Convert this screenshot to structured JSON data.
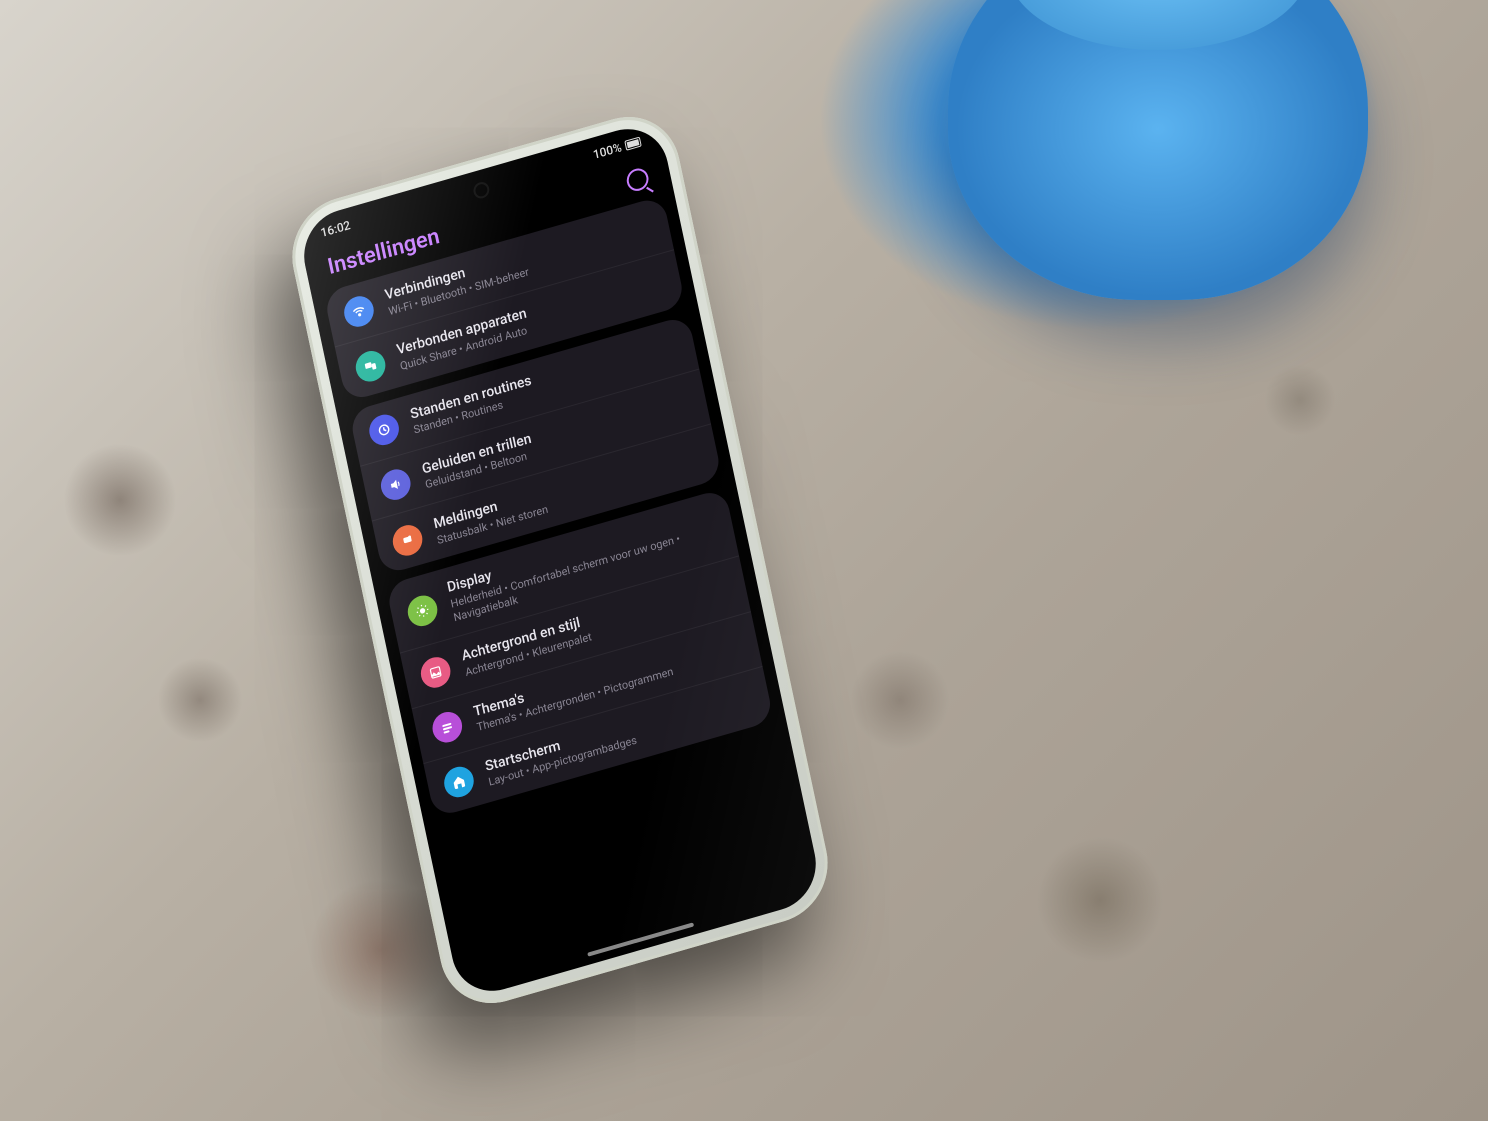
{
  "statusbar": {
    "time": "16:02",
    "battery_pct": "100%"
  },
  "header": {
    "title": "Instellingen"
  },
  "groups": [
    {
      "rows": [
        {
          "title": "Verbindingen",
          "sub": "Wi-Fi • Bluetooth • SIM-beheer"
        },
        {
          "title": "Verbonden apparaten",
          "sub": "Quick Share • Android Auto"
        }
      ]
    },
    {
      "rows": [
        {
          "title": "Standen en routines",
          "sub": "Standen • Routines"
        },
        {
          "title": "Geluiden en trillen",
          "sub": "Geluidstand • Beltoon"
        },
        {
          "title": "Meldingen",
          "sub": "Statusbalk • Niet storen"
        }
      ]
    },
    {
      "rows": [
        {
          "title": "Display",
          "sub": "Helderheid • Comfortabel scherm voor uw ogen • Navigatiebalk"
        },
        {
          "title": "Achtergrond en stijl",
          "sub": "Achtergrond • Kleurenpalet"
        },
        {
          "title": "Thema's",
          "sub": "Thema's • Achtergronden • Pictogrammen"
        },
        {
          "title": "Startscherm",
          "sub": "Lay-out • App-pictogrambadges"
        }
      ]
    }
  ]
}
